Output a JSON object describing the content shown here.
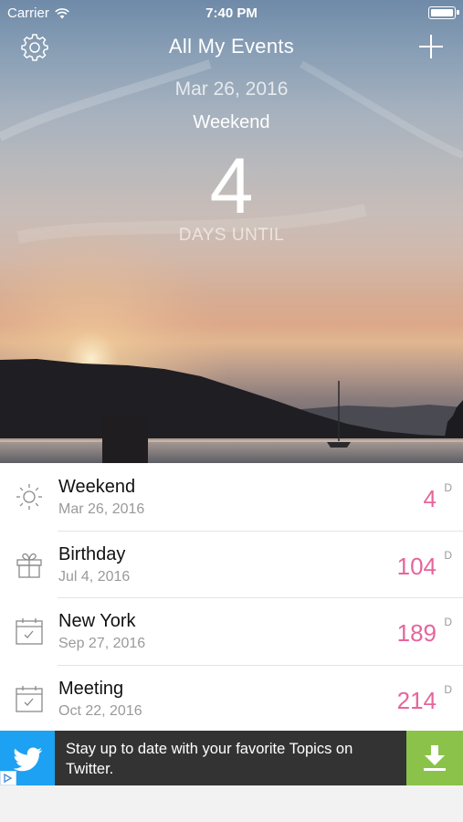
{
  "status_bar": {
    "carrier": "Carrier",
    "time": "7:40 PM",
    "icons": [
      "wifi-icon",
      "battery-icon"
    ]
  },
  "nav": {
    "title": "All My Events",
    "left_icon": "gear-icon",
    "right_icon": "plus-icon"
  },
  "featured": {
    "date": "Mar 26, 2016",
    "name": "Weekend",
    "count": "4",
    "unit_label": "DAYS UNTIL"
  },
  "events": [
    {
      "icon": "sun-icon",
      "name": "Weekend",
      "date": "Mar 26, 2016",
      "days": "4",
      "unit": "D"
    },
    {
      "icon": "gift-icon",
      "name": "Birthday",
      "date": "Jul 4, 2016",
      "days": "104",
      "unit": "D"
    },
    {
      "icon": "calendar-icon",
      "name": "New York",
      "date": "Sep 27, 2016",
      "days": "189",
      "unit": "D"
    },
    {
      "icon": "calendar-icon",
      "name": "Meeting",
      "date": "Oct 22, 2016",
      "days": "214",
      "unit": "D"
    }
  ],
  "ad": {
    "text": "Stay up to date with your favorite Topics on Twitter.",
    "brand_icon": "twitter-bird-icon",
    "action_icon": "download-icon",
    "info_icon": "ad-choices-icon"
  },
  "colors": {
    "accent": "#e6659c",
    "secondary_text": "#9a9a9a",
    "ad_background": "#333333",
    "twitter_blue": "#1da1f2",
    "download_green": "#8bc34a"
  }
}
